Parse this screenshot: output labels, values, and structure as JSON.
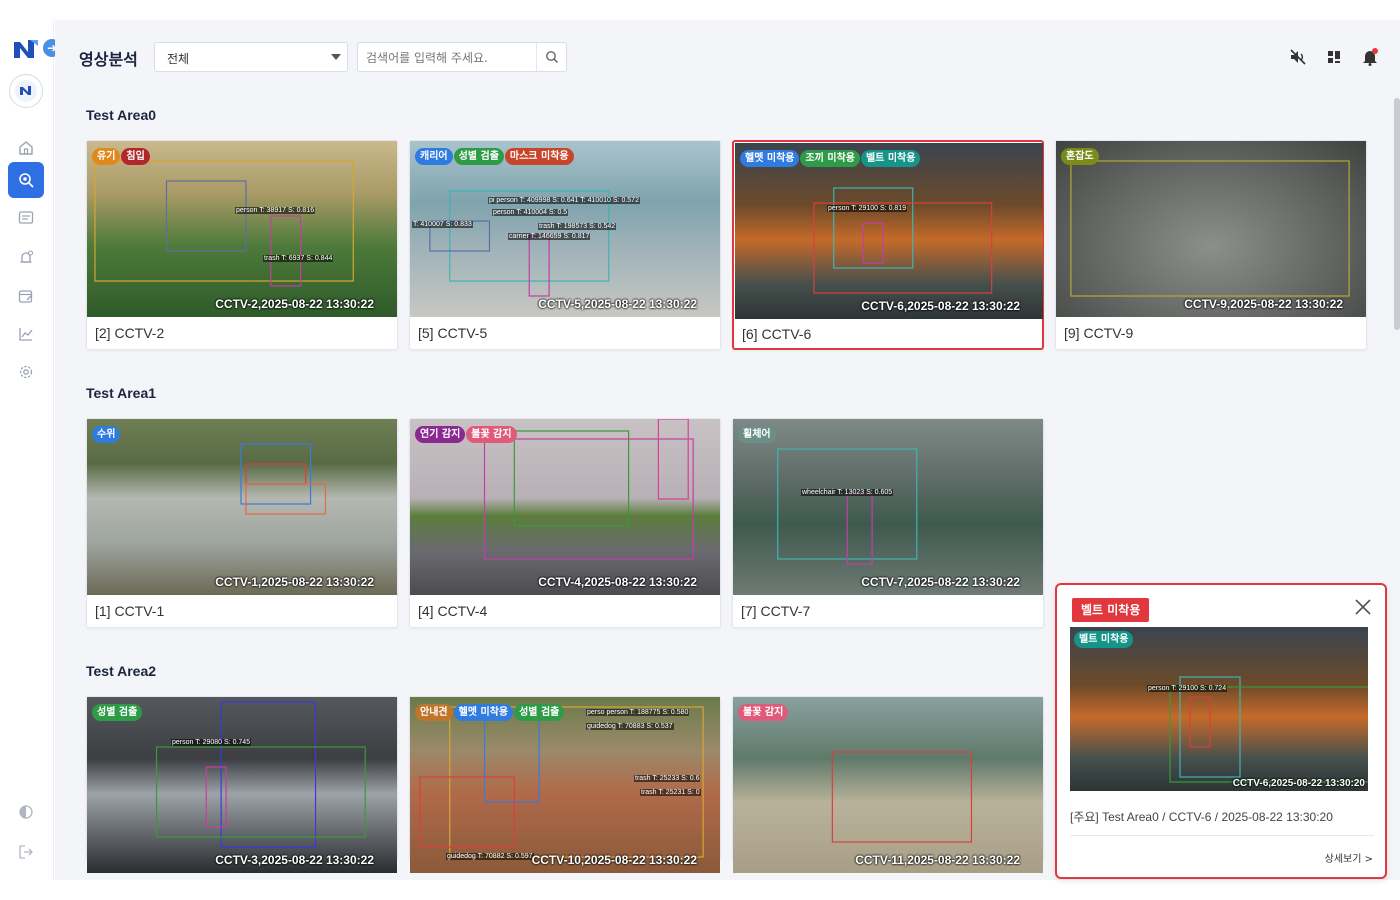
{
  "header": {
    "title": "영상분석",
    "filter_value": "전체",
    "search_placeholder": "검색어를 입력해 주세요."
  },
  "areas": [
    {
      "title": "Test Area0",
      "cards": [
        {
          "label": "[2] CCTV-2",
          "stamp": "CCTV-2,2025-08-22 13:30:22",
          "tags": [
            {
              "text": "유기",
              "color": "#e08a1e"
            },
            {
              "text": "침입",
              "color": "#b3262c"
            }
          ],
          "dets": [
            "person T: 38917 S: 0.816",
            "trash T: 6937 S: 0.844"
          ]
        },
        {
          "label": "[5] CCTV-5",
          "stamp": "CCTV-5,2025-08-22 13:30:22",
          "tags": [
            {
              "text": "캐리어",
              "color": "#2f7be0"
            },
            {
              "text": "성별 검출",
              "color": "#2e9b47"
            },
            {
              "text": "마스크 미착용",
              "color": "#c8452c"
            }
          ],
          "dets": [
            "person T: 410004 S: 0.5",
            "pi person T: 409998 S: 0.641 T: 410010 S: 0.572",
            "trash T: 198573 S: 0.542",
            "carrier T: 146659 S: 0.817",
            "T: 410007 S: 0.833"
          ]
        },
        {
          "label": "[6] CCTV-6",
          "stamp": "CCTV-6,2025-08-22 13:30:22",
          "tags": [
            {
              "text": "헬멧 미착용",
              "color": "#2f7be0"
            },
            {
              "text": "조끼 미착용",
              "color": "#2e9b47"
            },
            {
              "text": "벨트 미착용",
              "color": "#15948a"
            }
          ],
          "dets": [
            "person T: 29100 S: 0.819"
          ]
        },
        {
          "label": "[9] CCTV-9",
          "stamp": "CCTV-9,2025-08-22 13:30:22",
          "tags": [
            {
              "text": "혼잡도",
              "color": "#7a8b1c"
            }
          ],
          "dets": []
        }
      ]
    },
    {
      "title": "Test Area1",
      "cards": [
        {
          "label": "[1] CCTV-1",
          "stamp": "CCTV-1,2025-08-22 13:30:22",
          "tags": [
            {
              "text": "수위",
              "color": "#2f7be0"
            }
          ],
          "dets": []
        },
        {
          "label": "[4] CCTV-4",
          "stamp": "CCTV-4,2025-08-22 13:30:22",
          "tags": [
            {
              "text": "연기 감지",
              "color": "#8a2a90"
            },
            {
              "text": "불꽃 감지",
              "color": "#e05a7a"
            }
          ],
          "dets": []
        },
        {
          "label": "[7] CCTV-7",
          "stamp": "CCTV-7,2025-08-22 13:30:22",
          "tags": [
            {
              "text": "휠체어",
              "color": "#6a8f86"
            }
          ],
          "dets": [
            "wheelchair T: 13023 S: 0.605"
          ]
        }
      ]
    },
    {
      "title": "Test Area2",
      "cards": [
        {
          "label": "[3] CCTV-3",
          "stamp": "CCTV-3,2025-08-22 13:30:22",
          "tags": [
            {
              "text": "성별 검출",
              "color": "#2e9b47"
            }
          ],
          "dets": [
            "person T: 29080 S: 0.745"
          ]
        },
        {
          "label": "[10] CCTV-10",
          "stamp": "CCTV-10,2025-08-22 13:30:22",
          "tags": [
            {
              "text": "안내견",
              "color": "#c0762a"
            },
            {
              "text": "헬멧 미착용",
              "color": "#2f7be0"
            },
            {
              "text": "성별 검출",
              "color": "#2e9b47"
            }
          ],
          "dets": [
            "perso person T: 188775 S: 0.580",
            "guidedog T: 70883 S: 0.537",
            "trash T: 25233 S: 0.6",
            "trash T: 25231 S: 0",
            "guidedog T: 70882 S: 0.597"
          ]
        },
        {
          "label": "[11] CCTV-11",
          "stamp": "CCTV-11,2025-08-22 13:30:22",
          "tags": [
            {
              "text": "불꽃 감지",
              "color": "#e05a7a"
            }
          ],
          "dets": []
        }
      ]
    }
  ],
  "popup": {
    "badge": "벨트 미착용",
    "thumb_tag": "벨트 미착용",
    "thumb_det": "person T: 29100 S: 0.724",
    "thumb_stamp": "CCTV-6,2025-08-22 13:30:20",
    "info": "[주요] Test Area0 / CCTV-6 / 2025-08-22 13:30:20",
    "more": "상세보기 >"
  },
  "colors": {
    "accent": "#2f6fe4",
    "alert": "#e0383e",
    "background": "#f4f5f8"
  },
  "icons": [
    "logo-icon",
    "home-icon",
    "analysis-icon",
    "list-icon",
    "alarm-icon",
    "schedule-icon",
    "chart-icon",
    "settings-icon",
    "theme-icon",
    "logout-icon",
    "mute-icon",
    "grid-icon",
    "bell-icon"
  ]
}
